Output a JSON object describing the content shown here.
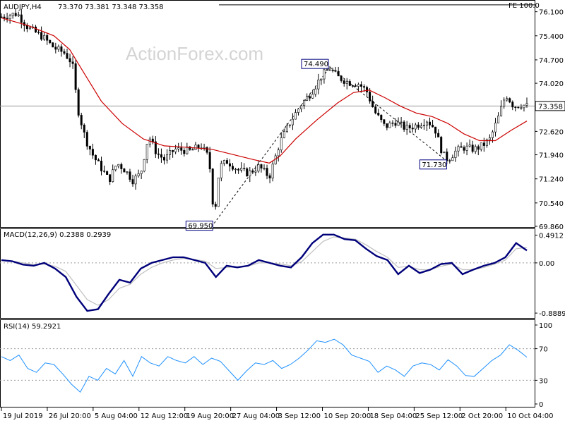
{
  "window": {
    "watermark": "ActionForex.com",
    "fe_label": "FE 100.0"
  },
  "chart_data": [
    {
      "type": "candlestick",
      "title": "AUDJPY,H4",
      "ohlc_label": "73.370 73.381 73.348 73.358",
      "last_price": 73.358,
      "last_price_label": "73.358",
      "ylim": [
        69.86,
        76.4
      ],
      "yticks": [
        "76.100",
        "75.400",
        "74.700",
        "74.020",
        "73.358",
        "72.620",
        "71.940",
        "71.240",
        "70.540",
        "69.860"
      ],
      "ytick_values": [
        76.1,
        75.4,
        74.7,
        74.02,
        73.358,
        72.62,
        71.94,
        71.24,
        70.54,
        69.86
      ],
      "xticks": [
        "19 Jul 2019",
        "26 Jul 20:00",
        "5 Aug 04:00",
        "12 Aug 12:00",
        "19 Aug 20:00",
        "27 Aug 04:00",
        "3 Sep 12:00",
        "10 Sep 20:00",
        "18 Sep 04:00",
        "25 Sep 12:00",
        "2 Oct 20:00",
        "10 Oct 04:00"
      ],
      "annotations": [
        {
          "label": "74.490",
          "value": 74.49
        },
        {
          "label": "69.950",
          "value": 69.95
        },
        {
          "label": "71.730",
          "value": 71.73
        }
      ],
      "close_path": [
        [
          0,
          75.95
        ],
        [
          0.03,
          76.05
        ],
        [
          0.05,
          75.65
        ],
        [
          0.08,
          75.35
        ],
        [
          0.1,
          75.05
        ],
        [
          0.12,
          74.9
        ],
        [
          0.135,
          74.6
        ],
        [
          0.145,
          73.3
        ],
        [
          0.16,
          72.4
        ],
        [
          0.175,
          71.9
        ],
        [
          0.19,
          71.55
        ],
        [
          0.205,
          71.2
        ],
        [
          0.22,
          71.7
        ],
        [
          0.235,
          71.5
        ],
        [
          0.25,
          71.2
        ],
        [
          0.265,
          71.4
        ],
        [
          0.28,
          72.5
        ],
        [
          0.295,
          72.0
        ],
        [
          0.31,
          71.8
        ],
        [
          0.33,
          72.1
        ],
        [
          0.36,
          72.05
        ],
        [
          0.38,
          72.2
        ],
        [
          0.395,
          71.85
        ],
        [
          0.405,
          70.1
        ],
        [
          0.415,
          71.6
        ],
        [
          0.43,
          71.75
        ],
        [
          0.45,
          71.5
        ],
        [
          0.47,
          71.4
        ],
        [
          0.49,
          71.6
        ],
        [
          0.51,
          71.3
        ],
        [
          0.53,
          72.3
        ],
        [
          0.55,
          72.9
        ],
        [
          0.57,
          73.4
        ],
        [
          0.59,
          73.75
        ],
        [
          0.61,
          74.25
        ],
        [
          0.625,
          74.45
        ],
        [
          0.64,
          74.2
        ],
        [
          0.66,
          74.05
        ],
        [
          0.68,
          74.0
        ],
        [
          0.695,
          73.8
        ],
        [
          0.71,
          73.2
        ],
        [
          0.73,
          72.75
        ],
        [
          0.75,
          72.9
        ],
        [
          0.77,
          72.7
        ],
        [
          0.79,
          72.8
        ],
        [
          0.81,
          72.95
        ],
        [
          0.825,
          72.7
        ],
        [
          0.84,
          71.95
        ],
        [
          0.85,
          71.8
        ],
        [
          0.865,
          72.05
        ],
        [
          0.88,
          72.15
        ],
        [
          0.9,
          72.1
        ],
        [
          0.915,
          72.2
        ],
        [
          0.93,
          72.4
        ],
        [
          0.945,
          73.0
        ],
        [
          0.96,
          73.7
        ],
        [
          0.975,
          73.35
        ],
        [
          0.99,
          73.4
        ],
        [
          1,
          73.358
        ]
      ],
      "ma_path": [
        [
          0,
          75.92
        ],
        [
          0.05,
          75.7
        ],
        [
          0.1,
          75.4
        ],
        [
          0.13,
          75.0
        ],
        [
          0.16,
          74.25
        ],
        [
          0.19,
          73.5
        ],
        [
          0.23,
          72.85
        ],
        [
          0.27,
          72.4
        ],
        [
          0.31,
          72.2
        ],
        [
          0.36,
          72.15
        ],
        [
          0.4,
          72.1
        ],
        [
          0.44,
          71.95
        ],
        [
          0.48,
          71.8
        ],
        [
          0.51,
          71.7
        ],
        [
          0.53,
          71.9
        ],
        [
          0.56,
          72.4
        ],
        [
          0.6,
          72.95
        ],
        [
          0.64,
          73.45
        ],
        [
          0.67,
          73.75
        ],
        [
          0.7,
          73.82
        ],
        [
          0.73,
          73.6
        ],
        [
          0.76,
          73.35
        ],
        [
          0.79,
          73.15
        ],
        [
          0.82,
          73.05
        ],
        [
          0.85,
          72.85
        ],
        [
          0.88,
          72.55
        ],
        [
          0.91,
          72.35
        ],
        [
          0.94,
          72.35
        ],
        [
          0.97,
          72.65
        ],
        [
          1,
          72.92
        ]
      ],
      "fe_level": 76.3,
      "fib_line": [
        [
          0.405,
          69.95
        ],
        [
          0.625,
          74.49
        ],
        [
          0.85,
          71.73
        ]
      ]
    },
    {
      "type": "line",
      "title": "MACD(12,26,9) 0.2388 0.2939",
      "ylim": [
        -0.95,
        0.56
      ],
      "yticks": [
        "0.4912",
        "0.00",
        "-0.8889"
      ],
      "ytick_values": [
        0.4912,
        0.0,
        -0.8889
      ],
      "zero_line": 0.0,
      "series": [
        {
          "role": "macd",
          "color": "#00007a",
          "values": [
            0.05,
            0.03,
            -0.03,
            -0.05,
            0.0,
            -0.1,
            -0.25,
            -0.6,
            -0.85,
            -0.82,
            -0.55,
            -0.3,
            -0.35,
            -0.1,
            0.0,
            0.05,
            0.1,
            0.1,
            0.05,
            0.0,
            -0.25,
            -0.05,
            -0.08,
            -0.05,
            0.05,
            0.0,
            -0.05,
            -0.08,
            0.1,
            0.35,
            0.5,
            0.5,
            0.42,
            0.4,
            0.25,
            0.12,
            0.05,
            -0.2,
            -0.05,
            -0.18,
            -0.12,
            -0.02,
            0.0,
            -0.2,
            -0.12,
            -0.05,
            0.0,
            0.1,
            0.35,
            0.22
          ]
        },
        {
          "role": "signal",
          "color": "#c0c0c0",
          "values": [
            0.04,
            0.03,
            0.0,
            -0.03,
            -0.02,
            -0.06,
            -0.15,
            -0.4,
            -0.65,
            -0.75,
            -0.65,
            -0.45,
            -0.38,
            -0.2,
            -0.08,
            0.0,
            0.05,
            0.08,
            0.06,
            0.03,
            -0.1,
            -0.08,
            -0.07,
            -0.06,
            0.0,
            0.0,
            -0.02,
            -0.05,
            0.02,
            0.2,
            0.38,
            0.46,
            0.44,
            0.42,
            0.32,
            0.2,
            0.1,
            -0.08,
            -0.06,
            -0.12,
            -0.12,
            -0.06,
            -0.02,
            -0.12,
            -0.12,
            -0.08,
            -0.02,
            0.05,
            0.25,
            0.27
          ]
        }
      ]
    },
    {
      "type": "line",
      "title": "RSI(14) 59.2921",
      "ylim": [
        0,
        100
      ],
      "yticks": [
        "100",
        "70",
        "30",
        "0"
      ],
      "ytick_values": [
        100,
        70,
        30,
        0
      ],
      "levels": [
        70,
        30
      ],
      "series": [
        {
          "role": "rsi",
          "color": "#1e90ff",
          "values": [
            60,
            55,
            62,
            45,
            40,
            52,
            50,
            38,
            25,
            15,
            35,
            30,
            45,
            38,
            55,
            35,
            60,
            52,
            48,
            60,
            55,
            52,
            60,
            50,
            58,
            54,
            42,
            30,
            42,
            52,
            50,
            55,
            45,
            50,
            58,
            68,
            80,
            78,
            82,
            75,
            62,
            58,
            54,
            40,
            48,
            43,
            35,
            48,
            52,
            50,
            43,
            56,
            48,
            36,
            35,
            45,
            55,
            62,
            75,
            68,
            59.29
          ]
        }
      ]
    }
  ]
}
